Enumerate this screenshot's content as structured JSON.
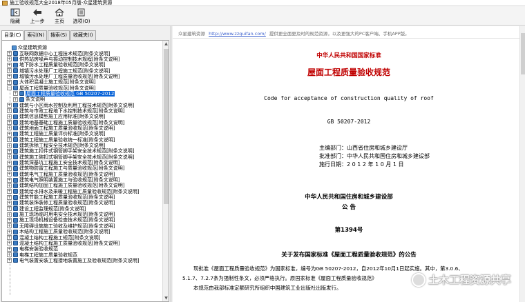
{
  "window": {
    "title": "施工验收规范大全2018年05月版-众星建筑资源"
  },
  "toolbar": [
    {
      "label": "隐藏",
      "icon": "hide-icon"
    },
    {
      "label": "上一步",
      "icon": "back-arrow-icon"
    },
    {
      "label": "主页",
      "icon": "home-icon"
    },
    {
      "label": "选项(O)",
      "icon": "options-icon"
    }
  ],
  "tabs": [
    "目录(C)",
    "索引(N)",
    "搜索(S)",
    "收藏夹(I)"
  ],
  "tree": [
    {
      "label": "众星建筑资源",
      "level": 0,
      "expander": "",
      "type": "root"
    },
    {
      "label": "互联网数据中心工程技术规范[附条文说明]",
      "level": 0,
      "expander": "+"
    },
    {
      "label": "供热站房噪声与振动控制技术规程[附条文说明]",
      "level": 0,
      "expander": "+"
    },
    {
      "label": "地下防水工程质量验收规范[附条文说明]",
      "level": 0,
      "expander": "+"
    },
    {
      "label": "城镇污水处理厂工程施工规范[附条文说明]",
      "level": 0,
      "expander": "+"
    },
    {
      "label": "城镇污水处理厂工程质量验收规范[附条文说明]",
      "level": 0,
      "expander": "+"
    },
    {
      "label": "大体积混凝土施工规范[附条文说明]",
      "level": 0,
      "expander": "+"
    },
    {
      "label": "屋面工程质量验收规范[附条文说明]",
      "level": 0,
      "expander": "−"
    },
    {
      "label": "屋面工程质量验收规范 GB 50207-2012",
      "level": 1,
      "expander": "+",
      "selected": true
    },
    {
      "label": "条文说明",
      "level": 1,
      "expander": "+"
    },
    {
      "label": "建筑与小区雨水控制及利用工程技术规范[附条文说明]",
      "level": 0,
      "expander": "+"
    },
    {
      "label": "建筑与市政工程地下水控制技术规范[附条文说明]",
      "level": 0,
      "expander": "+"
    },
    {
      "label": "建筑信息模型施工应用标准[附条文说明]",
      "level": 0,
      "expander": "+"
    },
    {
      "label": "建筑地基基础工程施工质量验收规范[附条文说明]",
      "level": 0,
      "expander": "+"
    },
    {
      "label": "建筑地面工程施工质量验收规范[附条文说明]",
      "level": 0,
      "expander": "+"
    },
    {
      "label": "建筑工程施工质量评价标准[附条文说明]",
      "level": 0,
      "expander": "+"
    },
    {
      "label": "建筑工程施工质量验收统一标准[附条文说明]",
      "level": 0,
      "expander": "+"
    },
    {
      "label": "建筑拆除工程安全技术规范[附条文说明]",
      "level": 0,
      "expander": "+"
    },
    {
      "label": "建筑施工扣件式钢管脚手架安全技术规范[附条文说明]",
      "level": 0,
      "expander": "+"
    },
    {
      "label": "建筑施工碗扣式钢管脚手架安全技术规范[附条文说明]",
      "level": 0,
      "expander": "+"
    },
    {
      "label": "建筑深基坑工程施工安全技术规范[附条文说明]",
      "level": 0,
      "expander": "+"
    },
    {
      "label": "建筑物防雷工程施工与质量验收规范[附条文说明]",
      "level": 0,
      "expander": "+"
    },
    {
      "label": "建筑电气工程施工质量验收规范[附条文说明]",
      "level": 0,
      "expander": "+"
    },
    {
      "label": "建筑电气照明装置施工与验收规范[附条文说明]",
      "level": 0,
      "expander": "+"
    },
    {
      "label": "建筑结构加固工程施工质量验收规范[附条文说明]",
      "level": 0,
      "expander": "+"
    },
    {
      "label": "建筑给水排水及采暖工程施工质量验收规范[附条文说明]",
      "level": 0,
      "expander": "+"
    },
    {
      "label": "建筑节能工程施工质量验收规范[附条文说明]",
      "level": 0,
      "expander": "+"
    },
    {
      "label": "建筑装饰装修工程质量验收规范[附条文说明]",
      "level": 0,
      "expander": "+"
    },
    {
      "label": "建设工程监理规范[附条文说明]",
      "level": 0,
      "expander": "+"
    },
    {
      "label": "施工现场临时用电安全技术规范[附条文说明]",
      "level": 0,
      "expander": "+"
    },
    {
      "label": "施工现场机械设备检查技术规范[附条文说明]",
      "level": 0,
      "expander": "+"
    },
    {
      "label": "无障碍设施施工验收及维护规范[附条文说明]",
      "level": 0,
      "expander": "+"
    },
    {
      "label": "木结构工程施工质量验收规范[附条文说明]",
      "level": 0,
      "expander": "+"
    },
    {
      "label": "混凝土结构工程施工规范[附条文说明]",
      "level": 0,
      "expander": "+"
    },
    {
      "label": "混凝土结构工程施工质量验收规范[附条文说明]",
      "level": 0,
      "expander": "+"
    },
    {
      "label": "电梯安装验收规范",
      "level": 0,
      "expander": "+"
    },
    {
      "label": "电梯工程施工质量验收规范",
      "level": 0,
      "expander": "+"
    },
    {
      "label": "电气装置安装工程接地装置施工及验收规范[附条文说明]",
      "level": 0,
      "expander": "+"
    }
  ],
  "content": {
    "source_prefix": "众星建筑资源",
    "source_url": "http://www.zzguifan.com/",
    "source_suffix": "提供更全面更及时的规范资源，以及更强大的PC客户端、手机APP版。",
    "issuer_top": "中华人民共和国国家标准",
    "doc_title": "屋面工程质量验收规范",
    "english_title": "Code for acceptance of construction quality of roof",
    "code": "GB 50207-2012",
    "editor_label": "主编部门：",
    "editor_value": "山西省住房和城乡建设厅",
    "approver_label": "批准部门：",
    "approver_value": "中华人民共和国住房和城乡建设部",
    "date_label": "施行日期：",
    "date_value": "2 0 1 2 年 1 0 月 1 日",
    "ministry": "中华人民共和国住房和城乡建设部",
    "announce": "公  告",
    "number": "第1394号",
    "notice_title": "关于发布国家标准《屋面工程质量验收规范》的公告",
    "para1": "现批准《屋面工程质量验收规范》为国家标准，编号为GB 50207-2012，自2012年10月1日起实施。其中，第3.0.6、",
    "para2": "5.1.7、7.2.7条为强制性条文，必须严格执行。原国家标准《屋面工程质量验收规范》",
    "para3": "本规范由我部标准定额研究所组织中国建筑工业出版社出版发行。"
  },
  "watermark": "土木工程资源共享",
  "colors": {
    "red_heading": "#c00000",
    "selection": "#0a64d8",
    "link": "#3a5fcd"
  }
}
